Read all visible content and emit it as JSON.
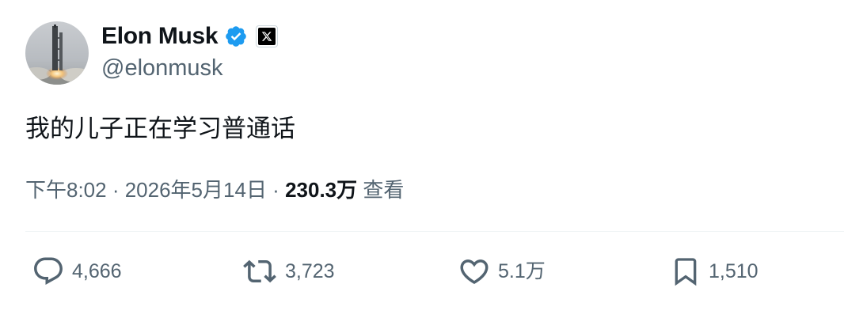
{
  "author": {
    "display_name": "Elon Musk",
    "handle": "@elonmusk",
    "verified": true,
    "verified_color": "#1d9bf0",
    "affiliate_badge_icon": "x-logo-icon",
    "avatar_subject": "rocket-launch"
  },
  "tweet": {
    "text": "我的儿子正在学习普通话"
  },
  "meta": {
    "time": "下午8:02",
    "separator": " · ",
    "date": "2026年5月14日",
    "views_count": "230.3万",
    "views_label": "查看"
  },
  "actions": {
    "reply": {
      "icon": "reply-icon",
      "count": "4,666"
    },
    "retweet": {
      "icon": "retweet-icon",
      "count": "3,723"
    },
    "like": {
      "icon": "heart-icon",
      "count": "5.1万"
    },
    "bookmark": {
      "icon": "bookmark-icon",
      "count": "1,510"
    }
  },
  "colors": {
    "text_primary": "#0f1419",
    "text_secondary": "#536471",
    "divider": "#eff3f4"
  }
}
